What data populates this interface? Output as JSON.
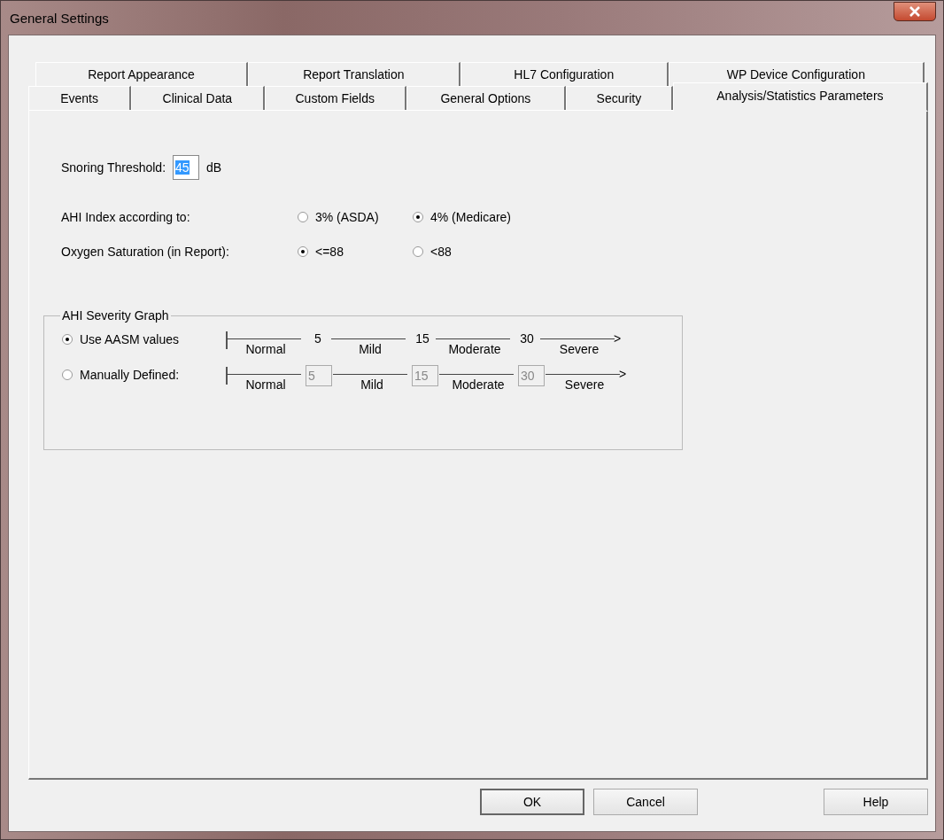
{
  "window": {
    "title": "General Settings"
  },
  "tab_rows": [
    [
      {
        "label": "Report Appearance",
        "selected": false
      },
      {
        "label": "Report Translation",
        "selected": false
      },
      {
        "label": "HL7 Configuration",
        "selected": false
      },
      {
        "label": "WP Device Configuration",
        "selected": false
      }
    ],
    [
      {
        "label": "Events",
        "selected": false
      },
      {
        "label": "Clinical Data",
        "selected": false
      },
      {
        "label": "Custom Fields",
        "selected": false
      },
      {
        "label": "General Options",
        "selected": false
      },
      {
        "label": "Security",
        "selected": false
      },
      {
        "label": "Analysis/Statistics Parameters",
        "selected": true
      }
    ]
  ],
  "snoring": {
    "label": "Snoring Threshold:",
    "value": "45",
    "unit": "dB"
  },
  "radio_rows": [
    {
      "label": "AHI Index according to:",
      "options": [
        {
          "label": "3% (ASDA)",
          "selected": false
        },
        {
          "label": "4% (Medicare)",
          "selected": true
        }
      ]
    },
    {
      "label": "Oxygen Saturation (in Report):",
      "options": [
        {
          "label": "<=88",
          "selected": true
        },
        {
          "label": "<88",
          "selected": false
        }
      ]
    }
  ],
  "severity_graph": {
    "title": "AHI Severity Graph",
    "rows": [
      {
        "label": "Use AASM values",
        "selected": true,
        "kind": "static",
        "thresholds": [
          "5",
          "15",
          "30"
        ],
        "categories": [
          "Normal",
          "Mild",
          "Moderate",
          "Severe"
        ],
        "arrow": ">"
      },
      {
        "label": "Manually Defined:",
        "selected": false,
        "kind": "editable",
        "thresholds": [
          "5",
          "15",
          "30"
        ],
        "categories": [
          "Normal",
          "Mild",
          "Moderate",
          "Severe"
        ],
        "arrow": ">"
      }
    ]
  },
  "buttons": [
    {
      "label": "OK",
      "default": true
    },
    {
      "label": "Cancel",
      "default": false
    },
    {
      "label": "Help",
      "default": false
    }
  ]
}
